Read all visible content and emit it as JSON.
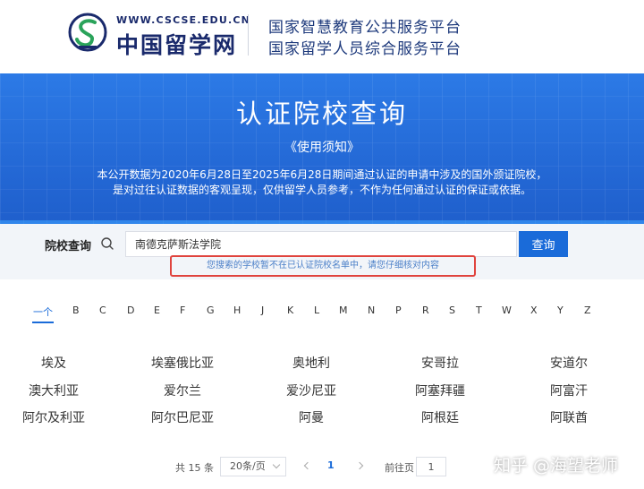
{
  "header": {
    "logo_url": "WWW.CSCSE.EDU.CN",
    "logo_name": "中国留学网",
    "platform_line1": "国家智慧教育公共服务平台",
    "platform_line2": "国家留学人员综合服务平台"
  },
  "banner": {
    "title": "认证院校查询",
    "usage_link": "《使用须知》",
    "description_line1": "本公开数据为2020年6月28日至2025年6月28日期间通过认证的申请中涉及的国外颁证院校，",
    "description_line2": "是对过往认证数据的客观呈现，仅供留学人员参考，不作为任何通过认证的保证或依据。"
  },
  "search": {
    "label": "院校查询",
    "input_value": "南德克萨斯法学院",
    "button_label": "查询",
    "notice": "您搜索的学校暂不在已认证院校名单中，请您仔细核对内容"
  },
  "alphabet": [
    "一个",
    "B",
    "C",
    "D",
    "E",
    "F",
    "G",
    "H",
    "J",
    "K",
    "L",
    "M",
    "N",
    "P",
    "R",
    "S",
    "T",
    "W",
    "X",
    "Y",
    "Z"
  ],
  "countries": [
    "埃及",
    "埃塞俄比亚",
    "奥地利",
    "安哥拉",
    "安道尔",
    "澳大利亚",
    "爱尔兰",
    "爱沙尼亚",
    "阿塞拜疆",
    "阿富汗",
    "阿尔及利亚",
    "阿尔巴尼亚",
    "阿曼",
    "阿根廷",
    "阿联酋"
  ],
  "pagination": {
    "total": "共 15 条",
    "page_size": "20条/页",
    "current_page": "1",
    "goto_label": "前往页",
    "goto_value": "1"
  },
  "watermark": "知乎 @海望老师",
  "colors": {
    "accent": "#1a6bd9",
    "banner": "#2469d6",
    "notice_border": "#e0443e"
  }
}
